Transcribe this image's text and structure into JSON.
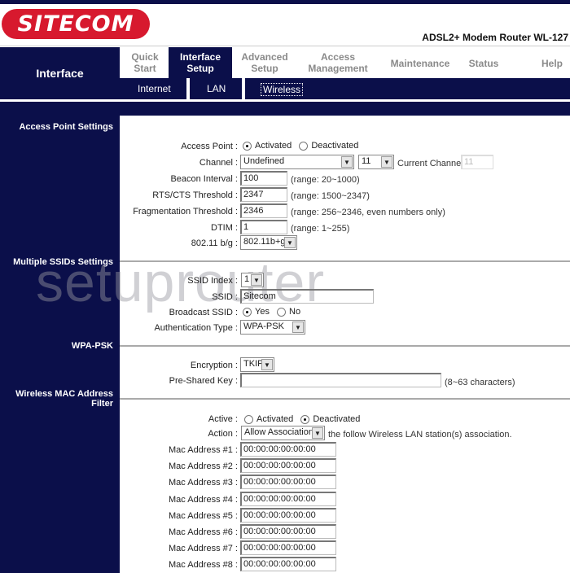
{
  "brand": {
    "logo_text": "SITECOM",
    "product": "ADSL2+ Modem Router WL-127",
    "brand_color": "#d7192e",
    "nav_color": "#0b0f4a"
  },
  "nav": {
    "section_title": "Interface",
    "tabs": [
      {
        "label_l1": "Quick",
        "label_l2": "Start",
        "active": false
      },
      {
        "label_l1": "Interface",
        "label_l2": "Setup",
        "active": true
      },
      {
        "label_l1": "Advanced",
        "label_l2": "Setup",
        "active": false
      },
      {
        "label_l1": "Access",
        "label_l2": "Management",
        "active": false
      },
      {
        "label_l1": "Maintenance",
        "label_l2": "",
        "active": false
      },
      {
        "label_l1": "Status",
        "label_l2": "",
        "active": false
      },
      {
        "label_l1": "Help",
        "label_l2": "",
        "active": false
      }
    ],
    "subtabs": [
      {
        "label": "Internet",
        "active": false
      },
      {
        "label": "LAN",
        "active": false
      },
      {
        "label": "Wireless",
        "active": true
      }
    ]
  },
  "sections": {
    "access_point": "Access Point Settings",
    "multiple_ssid": "Multiple SSIDs Settings",
    "wpa_psk": "WPA-PSK",
    "mac_filter_l1": "Wireless MAC Address",
    "mac_filter_l2": "Filter"
  },
  "ap": {
    "access_point_label": "Access Point :",
    "ap_options": [
      "Activated",
      "Deactivated"
    ],
    "ap_selected": "Activated",
    "channel_label": "Channel :",
    "channel_region": "Undefined",
    "channel_value": "11",
    "current_channel_label": "Current Channel:",
    "current_channel_value": "11",
    "beacon_label": "Beacon Interval :",
    "beacon_value": "100",
    "beacon_range": "(range: 20~1000)",
    "rts_label": "RTS/CTS Threshold :",
    "rts_value": "2347",
    "rts_range": "(range: 1500~2347)",
    "frag_label": "Fragmentation Threshold :",
    "frag_value": "2346",
    "frag_range": "(range: 256~2346, even numbers only)",
    "dtim_label": "DTIM :",
    "dtim_value": "1",
    "dtim_range": "(range: 1~255)",
    "mode_label": "802.11 b/g :",
    "mode_value": "802.11b+g"
  },
  "ssid": {
    "index_label": "SSID Index :",
    "index_value": "1",
    "ssid_label": "SSID :",
    "ssid_value": "Sitecom",
    "broadcast_label": "Broadcast SSID :",
    "broadcast_options": [
      "Yes",
      "No"
    ],
    "broadcast_selected": "Yes",
    "auth_label": "Authentication Type :",
    "auth_value": "WPA-PSK"
  },
  "wpa": {
    "encryption_label": "Encryption :",
    "encryption_value": "TKIP",
    "psk_label": "Pre-Shared Key :",
    "psk_value": "",
    "psk_hint": "(8~63 characters)"
  },
  "mac_filter": {
    "active_label": "Active :",
    "active_options": [
      "Activated",
      "Deactivated"
    ],
    "active_selected": "Deactivated",
    "action_label": "Action :",
    "action_value": "Allow Association",
    "action_suffix": "the follow Wireless LAN station(s) association.",
    "addresses": [
      {
        "label": "Mac Address #1 :",
        "value": "00:00:00:00:00:00"
      },
      {
        "label": "Mac Address #2 :",
        "value": "00:00:00:00:00:00"
      },
      {
        "label": "Mac Address #3 :",
        "value": "00:00:00:00:00:00"
      },
      {
        "label": "Mac Address #4 :",
        "value": "00:00:00:00:00:00"
      },
      {
        "label": "Mac Address #5 :",
        "value": "00:00:00:00:00:00"
      },
      {
        "label": "Mac Address #6 :",
        "value": "00:00:00:00:00:00"
      },
      {
        "label": "Mac Address #7 :",
        "value": "00:00:00:00:00:00"
      },
      {
        "label": "Mac Address #8 :",
        "value": "00:00:00:00:00:00"
      }
    ]
  },
  "watermark": "setuprouter"
}
